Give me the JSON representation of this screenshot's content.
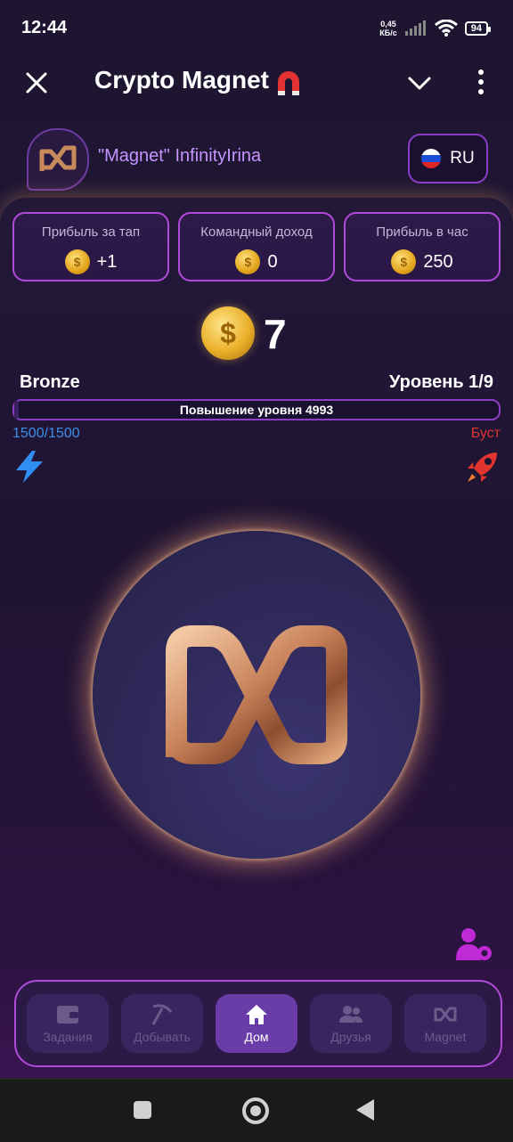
{
  "status": {
    "time": "12:44",
    "speed_value": "0,45",
    "speed_unit": "КБ/с",
    "battery": "94"
  },
  "header": {
    "title": "Crypto Magnet"
  },
  "profile": {
    "username": "\"Magnet\" InfinityIrina",
    "language": "RU"
  },
  "stats": [
    {
      "label": "Прибыль за тап",
      "value": "+1"
    },
    {
      "label": "Командный доход",
      "value": "0"
    },
    {
      "label": "Прибыль в час",
      "value": "250"
    }
  ],
  "balance": "7",
  "league": "Bronze",
  "level": "Уровень 1/9",
  "level_progress_text": "Повышение уровня 4993",
  "energy": "1500/1500",
  "boost": "Буст",
  "nav": [
    {
      "label": "Задания",
      "icon": "wallet-icon"
    },
    {
      "label": "Добывать",
      "icon": "pickaxe-icon"
    },
    {
      "label": "Дом",
      "icon": "home-icon"
    },
    {
      "label": "Друзья",
      "icon": "friends-icon"
    },
    {
      "label": "Magnet",
      "icon": "infinity-icon"
    }
  ],
  "colors": {
    "accent": "#b04ad8",
    "username": "#c594ff",
    "energy": "#3a8ee8",
    "boost": "#e0342e"
  }
}
